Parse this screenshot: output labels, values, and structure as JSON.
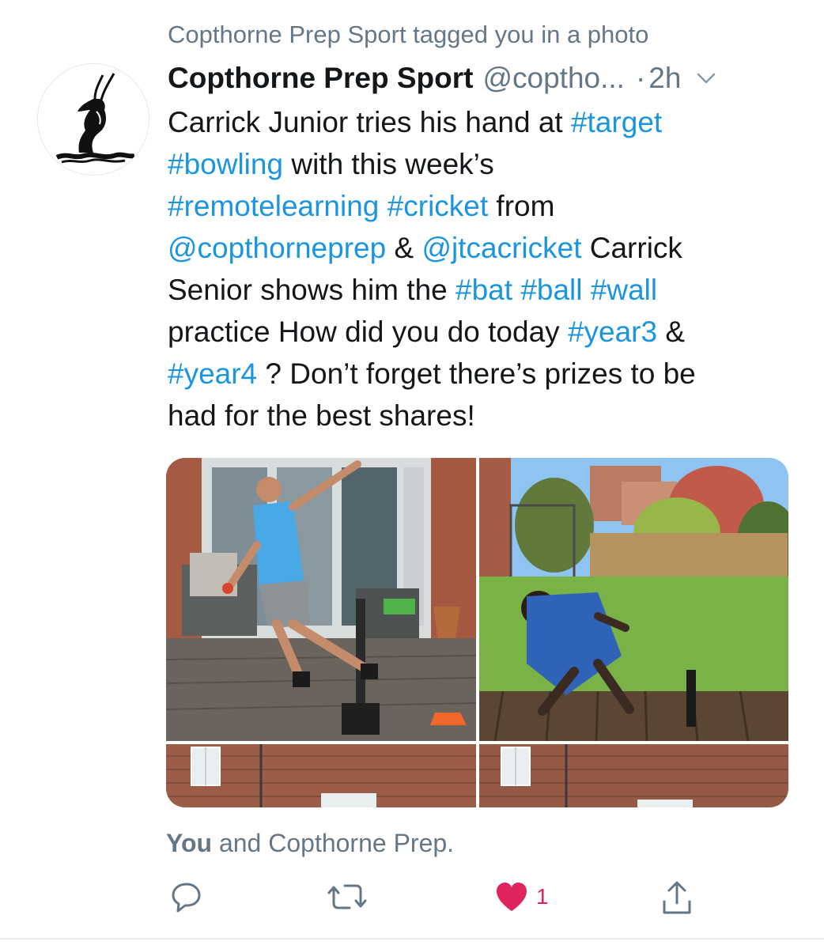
{
  "social_context": "Copthorne Prep Sport tagged you in a photo",
  "author": {
    "display_name": "Copthorne Prep Sport",
    "handle": "@coptho...",
    "separator": "·",
    "time": "2h"
  },
  "tweet_lines": [
    [
      {
        "t": "Carrick Junior tries his hand at "
      },
      {
        "t": "#target",
        "link": true
      }
    ],
    [
      {
        "t": "#bowling",
        "link": true
      },
      {
        "t": " with this week’s"
      }
    ],
    [
      {
        "t": "#remotelearning",
        "link": true
      },
      {
        "t": " "
      },
      {
        "t": "#cricket",
        "link": true
      },
      {
        "t": " from"
      }
    ],
    [
      {
        "t": "@copthorneprep",
        "link": true
      },
      {
        "t": " & "
      },
      {
        "t": "@jtcacricket",
        "link": true
      },
      {
        "t": " Carrick"
      }
    ],
    [
      {
        "t": "Senior shows him the "
      },
      {
        "t": "#bat",
        "link": true
      },
      {
        "t": " "
      },
      {
        "t": "#ball",
        "link": true
      },
      {
        "t": " "
      },
      {
        "t": "#wall",
        "link": true
      }
    ],
    [
      {
        "t": "practice How did you do today "
      },
      {
        "t": "#year3",
        "link": true
      },
      {
        "t": " &"
      }
    ],
    [
      {
        "t": "#year4",
        "link": true
      },
      {
        "t": " ? Don’t forget there’s prizes to be"
      }
    ],
    [
      {
        "t": "had for the best shares!"
      }
    ]
  ],
  "likes_line": {
    "bold": "You",
    "rest": " and Copthorne Prep."
  },
  "actions": {
    "like_count": "1"
  },
  "colors": {
    "link": "#1b95e0",
    "secondary": "#657786",
    "like": "#e0245e"
  },
  "icons": [
    "reply-icon",
    "retweet-icon",
    "heart-icon",
    "share-icon",
    "chevron-down-icon"
  ]
}
